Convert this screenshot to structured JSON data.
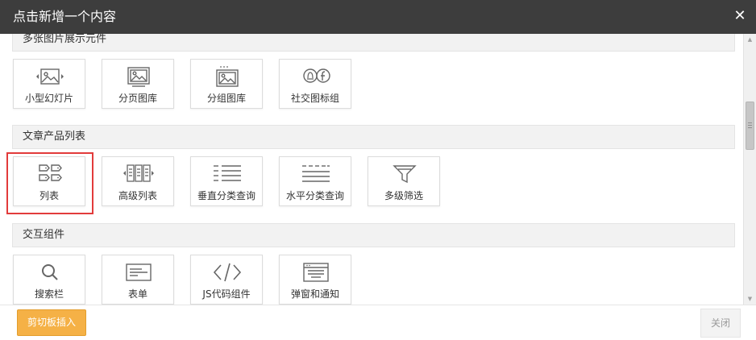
{
  "dialog": {
    "title": "点击新增一个内容",
    "close_symbol": "✕"
  },
  "sections": [
    {
      "label": "多张图片展示元件",
      "tiles": [
        {
          "label": "小型幻灯片",
          "icon": "slideshow-icon"
        },
        {
          "label": "分页图库",
          "icon": "paged-gallery-icon"
        },
        {
          "label": "分组图库",
          "icon": "grouped-gallery-icon"
        },
        {
          "label": "社交图标组",
          "icon": "social-icons-icon"
        }
      ]
    },
    {
      "label": "文章产品列表",
      "tiles": [
        {
          "label": "列表",
          "icon": "list-tags-icon"
        },
        {
          "label": "高级列表",
          "icon": "advanced-list-icon"
        },
        {
          "label": "垂直分类查询",
          "icon": "vertical-category-icon"
        },
        {
          "label": "水平分类查询",
          "icon": "horizontal-category-icon"
        },
        {
          "label": "多级筛选",
          "icon": "filter-funnel-icon"
        }
      ]
    },
    {
      "label": "交互组件",
      "tiles": [
        {
          "label": "搜索栏",
          "icon": "search-icon"
        },
        {
          "label": "表单",
          "icon": "form-icon"
        },
        {
          "label": "JS代码组件",
          "icon": "code-icon"
        },
        {
          "label": "弹窗和通知",
          "icon": "popup-notice-icon"
        }
      ]
    }
  ],
  "footer": {
    "paste_button": "剪切板插入",
    "close_button": "关闭"
  },
  "colors": {
    "titlebar": "#3d3d3d",
    "accent": "#f5b146",
    "selection": "#e23b3b"
  },
  "selected_tile": "列表"
}
